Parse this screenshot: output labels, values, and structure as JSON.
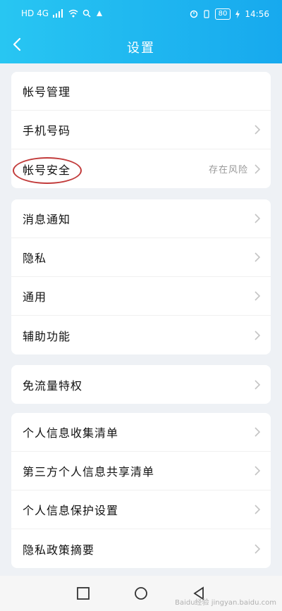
{
  "status_bar": {
    "left_text": "HD 4G",
    "time": "14:56",
    "battery": "80"
  },
  "header": {
    "title": "设置"
  },
  "groups": [
    {
      "items": [
        {
          "label": "帐号管理"
        },
        {
          "label": "手机号码"
        },
        {
          "label": "帐号安全",
          "right_text": "存在风险",
          "highlighted": true
        }
      ]
    },
    {
      "items": [
        {
          "label": "消息通知"
        },
        {
          "label": "隐私"
        },
        {
          "label": "通用"
        },
        {
          "label": "辅助功能"
        }
      ]
    },
    {
      "items": [
        {
          "label": "免流量特权"
        }
      ]
    },
    {
      "items": [
        {
          "label": "个人信息收集清单"
        },
        {
          "label": "第三方个人信息共享清单"
        },
        {
          "label": "个人信息保护设置"
        },
        {
          "label": "隐私政策摘要"
        }
      ]
    }
  ],
  "watermark": "Baidu经验 jingyan.baidu.com",
  "colors": {
    "header_start": "#28c6f2",
    "header_end": "#17a9ee",
    "highlight_circle": "#c23b3b"
  }
}
